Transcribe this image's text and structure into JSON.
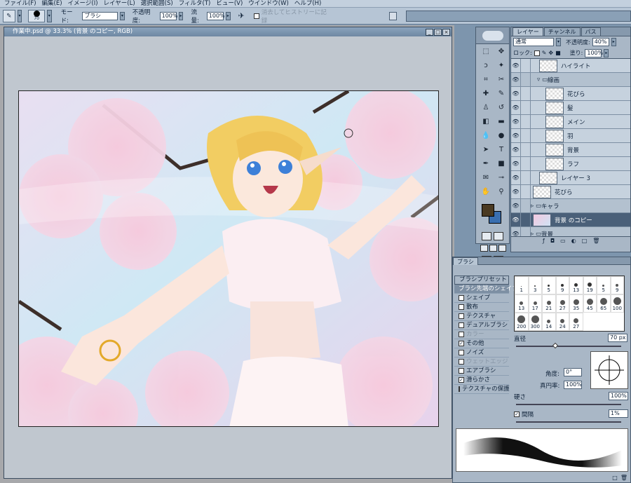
{
  "menu": [
    "ファイル(F)",
    "編集(E)",
    "イメージ(I)",
    "レイヤー(L)",
    "選択範囲(S)",
    "フィルタ(T)",
    "ビュー(V)",
    "ウインドウ(W)",
    "ヘルプ(H)"
  ],
  "options": {
    "brush_size": "70",
    "mode_label": "モード:",
    "mode_value": "ブラシ",
    "opacity_label": "不透明度:",
    "opacity_value": "100%",
    "flow_label": "流量:",
    "flow_value": "100%",
    "history_label": "消去してヒストリーに記録"
  },
  "document": {
    "title": "作業中.psd @ 33.3% (背景 のコピー, RGB)",
    "buttons": [
      "_",
      "□",
      "×"
    ]
  },
  "tools": [
    "marquee-icon",
    "move-icon",
    "lasso-icon",
    "magic-wand-icon",
    "crop-icon",
    "slice-icon",
    "heal-icon",
    "brush-icon",
    "stamp-icon",
    "history-brush-icon",
    "eraser-icon",
    "gradient-icon",
    "blur-icon",
    "dodge-icon",
    "path-select-icon",
    "type-icon",
    "pen-icon",
    "shape-icon",
    "notes-icon",
    "eyedropper-icon",
    "hand-icon",
    "zoom-icon"
  ],
  "colors": {
    "foreground": "#4a3a22",
    "background": "#3a6fb0",
    "accent": "#4a6079"
  },
  "layers": {
    "tabs": [
      "レイヤー",
      "チャンネル",
      "パス"
    ],
    "blend_mode": "通常",
    "opacity_label": "不透明度:",
    "opacity_value": "40%",
    "lock_label": "ロック:",
    "fill_label": "塗り:",
    "fill_value": "100%",
    "rows": [
      {
        "name": "ハイライト",
        "indent": 1,
        "kind": "layer"
      },
      {
        "name": "線画",
        "indent": 1,
        "kind": "group"
      },
      {
        "name": "花びら",
        "indent": 2,
        "kind": "layer"
      },
      {
        "name": "髪",
        "indent": 2,
        "kind": "layer"
      },
      {
        "name": "メイン",
        "indent": 2,
        "kind": "layer"
      },
      {
        "name": "羽",
        "indent": 2,
        "kind": "layer"
      },
      {
        "name": "背景",
        "indent": 2,
        "kind": "layer"
      },
      {
        "name": "ラフ",
        "indent": 2,
        "kind": "layer"
      },
      {
        "name": "レイヤー 3",
        "indent": 1,
        "kind": "layer"
      },
      {
        "name": "花びら",
        "indent": 0,
        "kind": "layer"
      },
      {
        "name": "キャラ",
        "indent": 0,
        "kind": "group"
      },
      {
        "name": "背景 のコピー",
        "indent": 0,
        "kind": "selected"
      },
      {
        "name": "背景",
        "indent": 0,
        "kind": "group"
      }
    ]
  },
  "brush": {
    "tab": "ブラシ",
    "presets_label": "ブラシプリセット",
    "items": [
      {
        "label": "ブラシ先端のシェイプ",
        "checked": null,
        "head": true
      },
      {
        "label": "シェイプ",
        "checked": false
      },
      {
        "label": "散布",
        "checked": false
      },
      {
        "label": "テクスチャ",
        "checked": false
      },
      {
        "label": "デュアルブラシ",
        "checked": false
      },
      {
        "label": "カラー",
        "checked": false,
        "gray": true
      },
      {
        "label": "その他",
        "checked": true
      },
      {
        "label": "ノイズ",
        "checked": false
      },
      {
        "label": "ウェットエッジ",
        "checked": false,
        "gray": true
      },
      {
        "label": "エアブラシ",
        "checked": false
      },
      {
        "label": "滑らかさ",
        "checked": true
      },
      {
        "label": "テクスチャの保護",
        "checked": false
      }
    ],
    "tips": [
      "1",
      "3",
      "5",
      "9",
      "13",
      "19",
      "5",
      "9",
      "13",
      "17",
      "21",
      "27",
      "35",
      "45",
      "65",
      "100",
      "200",
      "300",
      "14",
      "24",
      "27"
    ],
    "diameter_label": "直径",
    "diameter_value": "70 px",
    "angle_label": "角度:",
    "angle_value": "0°",
    "roundness_label": "真円率:",
    "roundness_value": "100%",
    "hardness_label": "硬さ",
    "hardness_value": "100%",
    "spacing_label": "間隔",
    "spacing_value": "1%"
  }
}
